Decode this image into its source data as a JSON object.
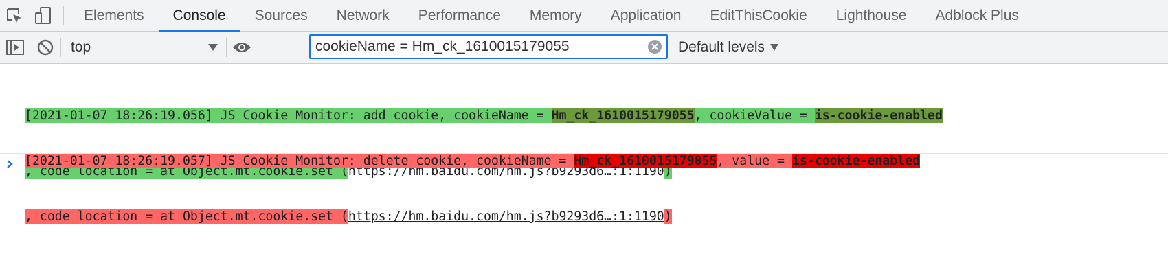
{
  "tabs": [
    {
      "label": "Elements"
    },
    {
      "label": "Console"
    },
    {
      "label": "Sources"
    },
    {
      "label": "Network"
    },
    {
      "label": "Performance"
    },
    {
      "label": "Memory"
    },
    {
      "label": "Application"
    },
    {
      "label": "EditThisCookie"
    },
    {
      "label": "Lighthouse"
    },
    {
      "label": "Adblock Plus"
    }
  ],
  "active_tab": "Console",
  "toolbar": {
    "context": "top",
    "filter_value": "cookieName = Hm_ck_1610015179055",
    "levels_label": "Default levels"
  },
  "messages": [
    {
      "prefix": "[2021-01-07 18:26:19.056] JS Cookie Monitor: add cookie, cookieName = ",
      "name": "Hm_ck_1610015179055",
      "mid": ", cookieValue = ",
      "value": "is-cookie-enabled",
      "loc_prefix": ", code location = at Object.mt.cookie.set (",
      "link": "https://hm.baidu.com/hm.js?b9293d6…:1:1190",
      "loc_suffix": ")"
    },
    {
      "prefix": "[2021-01-07 18:26:19.057] JS Cookie Monitor: delete cookie, cookieName = ",
      "name": "Hm_ck_1610015179055",
      "mid": ", value = ",
      "value": "is-cookie-enabled",
      "loc_prefix": ", code location = at Object.mt.cookie.set (",
      "link": "https://hm.baidu.com/hm.js?b9293d6…:1:1190",
      "loc_suffix": ")"
    }
  ],
  "colors": {
    "accent": "#1a73e8",
    "add_highlight": "#67cf6b",
    "add_value_highlight": "#6b9a3a",
    "delete_highlight": "#ff6666",
    "delete_value_highlight": "#e60000"
  }
}
